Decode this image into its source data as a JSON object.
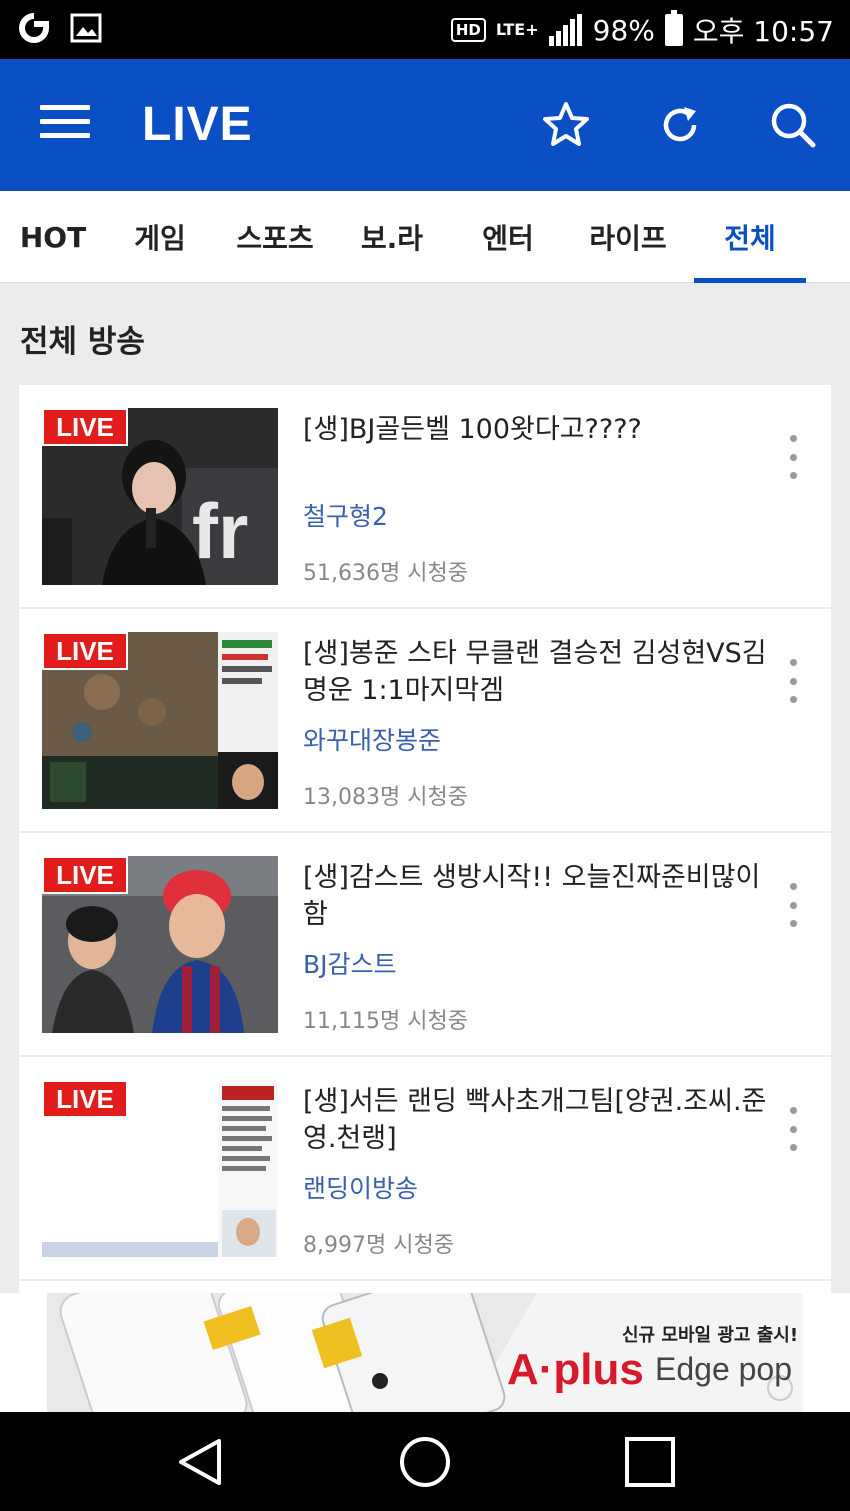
{
  "status_bar": {
    "battery": "98%",
    "time": "오후 10:57",
    "network": "LTE+",
    "hd": "HD"
  },
  "header": {
    "title": "LIVE"
  },
  "tabs": [
    {
      "label": "HOT",
      "active": false
    },
    {
      "label": "게임",
      "active": false
    },
    {
      "label": "스포츠",
      "active": false
    },
    {
      "label": "보.라",
      "active": false
    },
    {
      "label": "엔터",
      "active": false
    },
    {
      "label": "라이프",
      "active": false
    },
    {
      "label": "전체",
      "active": true
    }
  ],
  "section_title": "전체 방송",
  "live_badge": "LIVE",
  "streams": [
    {
      "title": "[생]BJ골든벨 100왓다고????",
      "bj": "철구형2",
      "viewers": "51,636명 시청중"
    },
    {
      "title": "[생]봉준 스타 무클랜 결승전 김성현VS김명운 1:1마지막겜",
      "bj": "와꾸대장봉준",
      "viewers": "13,083명 시청중"
    },
    {
      "title": "[생]감스트 생방시작!! 오늘진짜준비많이함",
      "bj": "BJ감스트",
      "viewers": "11,115명 시청중"
    },
    {
      "title": "[생]서든 랜딩 빡사초개그팀[양권.조씨.준영.천랭]",
      "bj": "랜딩이방송",
      "viewers": "8,997명 시청중"
    }
  ],
  "ad": {
    "headline": "신규 모바일 광고 출시!",
    "brand": "A·plus",
    "product": "Edge pop"
  },
  "colors": {
    "brand_blue": "#0a4fc4",
    "live_red": "#e21b1b",
    "bj_blue": "#3b5fae"
  }
}
